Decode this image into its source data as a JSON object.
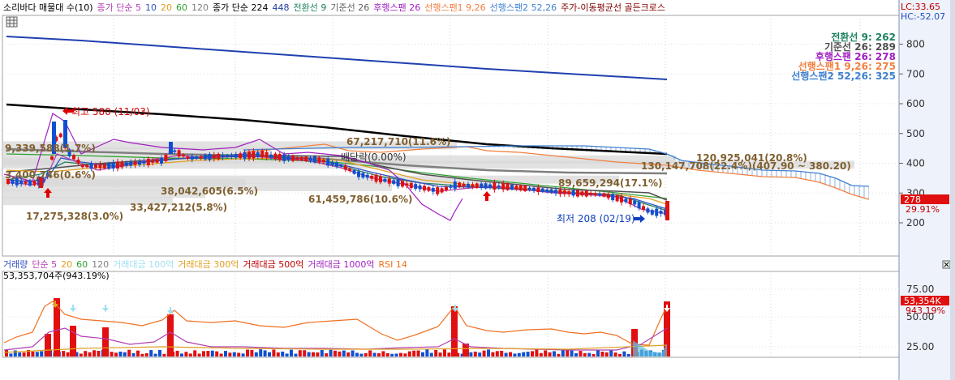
{
  "legend": {
    "main_items": [
      {
        "text": "소리바다 매물대 수(10)",
        "color": "#000000"
      },
      {
        "text": "종가 단순 5",
        "color": "#b040b0"
      },
      {
        "text": "10",
        "color": "#3050c0"
      },
      {
        "text": "20",
        "color": "#e0a020"
      },
      {
        "text": "60",
        "color": "#30a030"
      },
      {
        "text": "120",
        "color": "#808080"
      },
      {
        "text": "종가 단순 224",
        "color": "#000000"
      },
      {
        "text": "448",
        "color": "#2040a0"
      },
      {
        "text": "전환선 9",
        "color": "#208060"
      },
      {
        "text": "기준선 26",
        "color": "#606060"
      },
      {
        "text": "후행스팬 26",
        "color": "#a020c0"
      },
      {
        "text": "선행스팬1 9,26",
        "color": "#f08040"
      },
      {
        "text": "선행스팬2 52,26",
        "color": "#4080d0"
      },
      {
        "text": "주가-이동평균선 골든크로스",
        "color": "#800000"
      }
    ],
    "volume_items": [
      {
        "text": "거래량",
        "color": "#3050c0"
      },
      {
        "text": "단순 5",
        "color": "#b040b0"
      },
      {
        "text": "20",
        "color": "#e0a020"
      },
      {
        "text": "60",
        "color": "#30a030"
      },
      {
        "text": "120",
        "color": "#808080"
      },
      {
        "text": "거래대금 100억",
        "color": "#a0e0f0"
      },
      {
        "text": "거래대금 300억",
        "color": "#e0a020"
      },
      {
        "text": "거래대금 500억",
        "color": "#c00000"
      },
      {
        "text": "거래대금 1000억",
        "color": "#a020c0"
      },
      {
        "text": "RSI 14",
        "color": "#f07020"
      }
    ],
    "volume_value": "53,353,704주(943.19%)"
  },
  "right_info": {
    "lc": "LC:33.65",
    "hc": "HC:-52.07"
  },
  "chart_data": [
    {
      "type": "candlestick",
      "title": "소리바다 매물대 수(10)",
      "ylim": [
        150,
        900
      ],
      "y_ticks": [
        200,
        300,
        400,
        500,
        600,
        700,
        800
      ],
      "current_price_tag": "278",
      "current_change_tag": "29.91%",
      "moving_averages": {
        "ma448": [
          {
            "x": 0,
            "y": 822
          },
          {
            "x": 100,
            "y": 812
          },
          {
            "x": 200,
            "y": 800
          },
          {
            "x": 300,
            "y": 785
          },
          {
            "x": 400,
            "y": 766
          },
          {
            "x": 500,
            "y": 748
          },
          {
            "x": 600,
            "y": 728
          },
          {
            "x": 700,
            "y": 708
          },
          {
            "x": 800,
            "y": 689
          },
          {
            "x": 810,
            "y": 684
          }
        ],
        "ma224": [
          {
            "x": 0,
            "y": 592
          },
          {
            "x": 100,
            "y": 575
          },
          {
            "x": 200,
            "y": 558
          },
          {
            "x": 300,
            "y": 540
          },
          {
            "x": 400,
            "y": 518
          },
          {
            "x": 500,
            "y": 496
          },
          {
            "x": 600,
            "y": 474
          },
          {
            "x": 700,
            "y": 447
          },
          {
            "x": 810,
            "y": 432
          }
        ]
      },
      "ichimoku_lines": {
        "tenkan": {
          "label": "전환선 9: 262",
          "color": "#208060"
        },
        "kijun": {
          "label": "기준선 26: 289",
          "color": "#505050"
        },
        "chikou": {
          "label": "후행스팬 26: 278",
          "color": "#a020c0"
        },
        "senkou1": {
          "label": "선행스팬1 9,26: 275",
          "color": "#f08040"
        },
        "senkou2": {
          "label": "선행스팬2 52,26: 325",
          "color": "#4080d0"
        }
      },
      "volume_profile": [
        {
          "label": "9,339,588(1.7%)",
          "price": 440
        },
        {
          "label": "3,400,746(0.6%)",
          "price": 405
        },
        {
          "label": "67,217,710(11.6%)",
          "price": 460
        },
        {
          "label": "120,925,041(20.8%)",
          "price": 413
        },
        {
          "label": "130,147,708(22.4%)(407.90 ~ 380.20)",
          "price": 395
        },
        {
          "label": "89,659,294(17.1%)",
          "price": 345
        },
        {
          "label": "38,042,605(6.5%)",
          "price": 335
        },
        {
          "label": "61,459,786(10.6%)",
          "price": 320
        },
        {
          "label": "33,427,212(5.8%)",
          "price": 297
        },
        {
          "label": "17,275,328(3.0%)",
          "price": 273
        }
      ],
      "annotations": [
        {
          "label": "최고 580 (11/03)",
          "price": 580
        },
        {
          "label": "배당락(0.00%)",
          "price": 420
        },
        {
          "label": "최저 208 (02/19)",
          "price": 208
        }
      ]
    },
    {
      "type": "bar",
      "title": "거래량",
      "ylim": [
        0,
        100
      ],
      "y_ticks": [
        25,
        50,
        75
      ],
      "current_volume_tag": "53,354K",
      "current_pct_tag": "943.19%"
    }
  ]
}
